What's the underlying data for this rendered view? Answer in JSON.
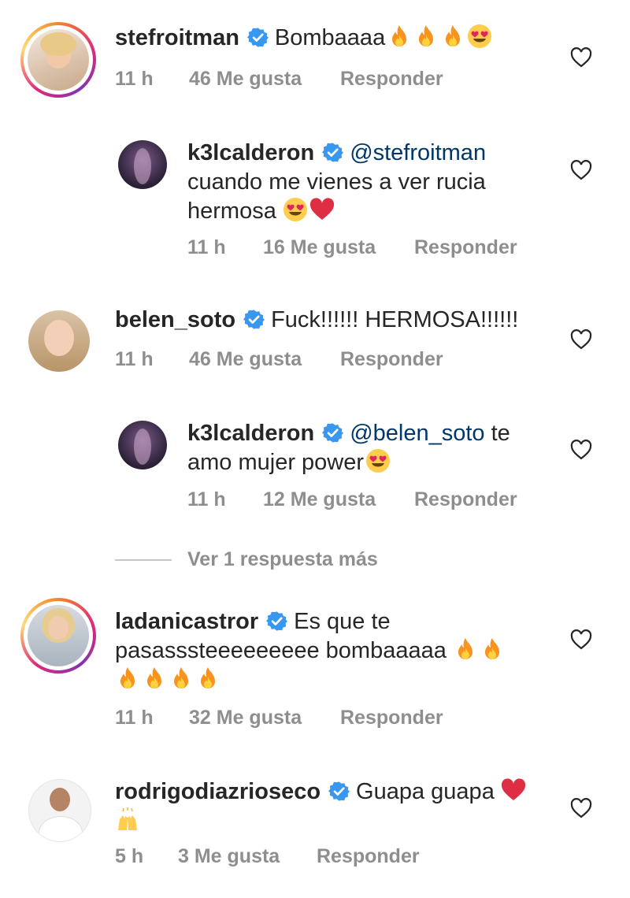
{
  "comments": [
    {
      "user": "stefroitman",
      "text": "Bombaaaa",
      "time": "11 h",
      "likes": "46 Me gusta",
      "reply": "Responder"
    },
    {
      "user": "k3lcalderon",
      "mention": "@stefroitman",
      "text_line1": "cuando me vienes a ver rucia",
      "text_line2": "hermosa",
      "time": "11 h",
      "likes": "16 Me gusta",
      "reply": "Responder"
    },
    {
      "user": "belen_soto",
      "text": "Fuck!!!!!! HERMOSA!!!!!!",
      "time": "11 h",
      "likes": "46 Me gusta",
      "reply": "Responder"
    },
    {
      "user": "k3lcalderon",
      "mention": "@belen_soto",
      "text_tail": " te",
      "text_line2": "amo mujer power",
      "time": "11 h",
      "likes": "12 Me gusta",
      "reply": "Responder"
    },
    {
      "user": "ladanicastror",
      "text": "Es que te",
      "text_line2": "pasasssteeeeeeeee bombaaaaa",
      "time": "11 h",
      "likes": "32 Me gusta",
      "reply": "Responder"
    },
    {
      "user": "rodrigodiazrioseco",
      "text": "Guapa guapa",
      "time": "5 h",
      "likes": "3 Me gusta",
      "reply": "Responder"
    }
  ],
  "view_more": "Ver 1 respuesta más",
  "colors": {
    "verified": "#3897f0",
    "mention": "#00376b",
    "meta": "#8e8e8e"
  },
  "icons": [
    "verified-badge-icon",
    "fire-emoji",
    "heart-eyes-emoji",
    "red-heart-emoji",
    "raising-hands-emoji",
    "heart-like-icon"
  ]
}
